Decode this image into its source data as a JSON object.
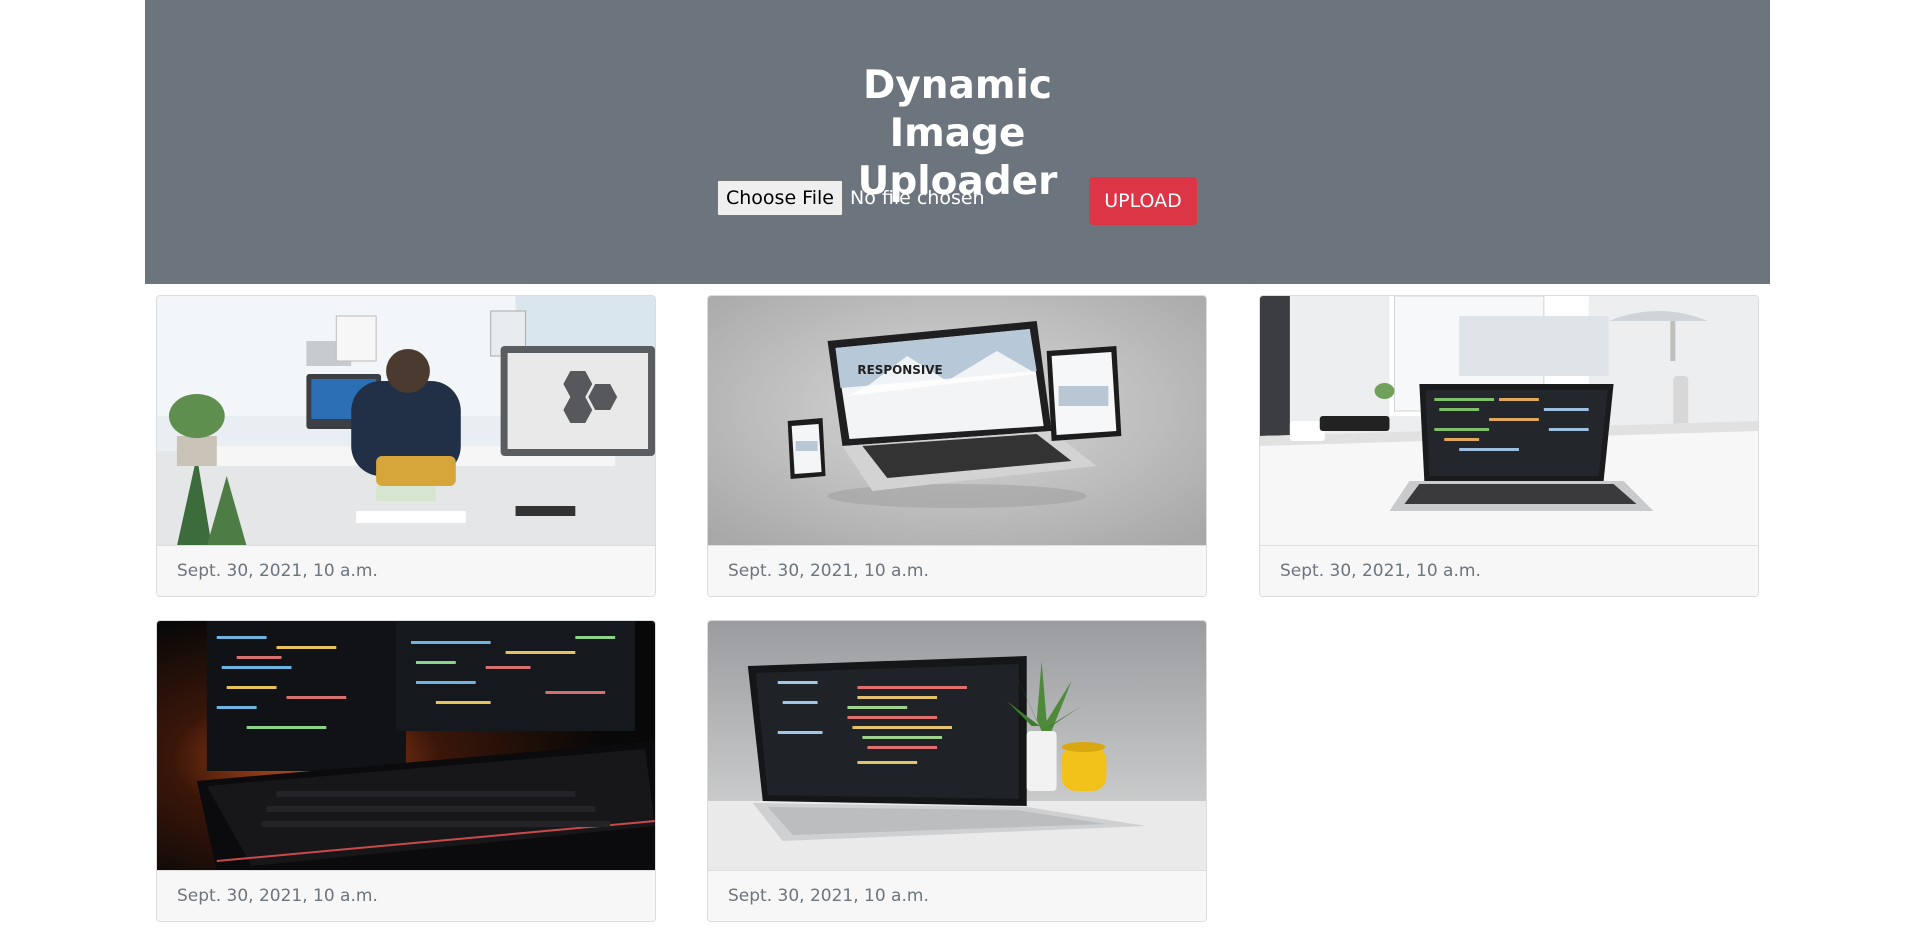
{
  "header": {
    "title": "Dynamic Image Uploader",
    "choose_file_label": "Choose File",
    "file_status": "No file chosen",
    "upload_label": "UPLOAD"
  },
  "colors": {
    "header_bg": "#6c757d",
    "upload_button": "#dc3545"
  },
  "gallery": {
    "cards": [
      {
        "image": "office-desk-man-at-computer",
        "date": "Sept. 30, 2021, 10 a.m."
      },
      {
        "image": "responsive-web-design-devices",
        "date": "Sept. 30, 2021, 10 a.m."
      },
      {
        "image": "laptop-with-code-on-desk",
        "date": "Sept. 30, 2021, 10 a.m."
      },
      {
        "image": "dark-monitors-code-keyboard",
        "date": "Sept. 30, 2021, 10 a.m."
      },
      {
        "image": "laptop-code-plant-mug",
        "date": "Sept. 30, 2021, 10 a.m."
      }
    ]
  }
}
